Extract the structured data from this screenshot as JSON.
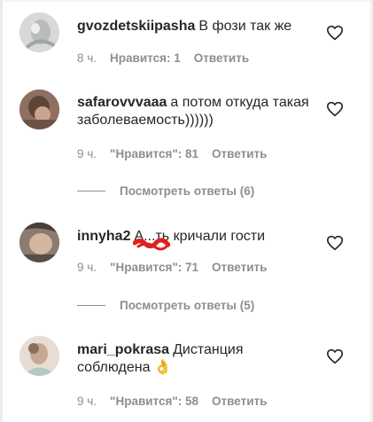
{
  "comments": [
    {
      "username": "gvozdetskiipasha",
      "text": "В фози так же",
      "time": "8 ч.",
      "likes": "Нравится: 1",
      "reply": "Ответить",
      "avatar_color": "#d9dcd9"
    },
    {
      "username": "safarovvvaaa",
      "text": "а потом откуда такая заболеваемость))))))",
      "time": "9 ч.",
      "likes": "\"Нравится\": 81",
      "reply": "Ответить",
      "replies_label": "Посмотреть ответы (6)",
      "avatar_color": "#8a6a5a"
    },
    {
      "username": "innyha2",
      "text": "А...ть кричали гости",
      "time": "9 ч.",
      "likes": "\"Нравится\": 71",
      "reply": "Ответить",
      "replies_label": "Посмотреть ответы (5)",
      "avatar_color": "#7a6a5e"
    },
    {
      "username": "mari_pokrasa",
      "text": "Дистанция соблюдена 👌",
      "time": "9 ч.",
      "likes": "\"Нравится\": 58",
      "reply": "Ответить",
      "avatar_color": "#e2d8cf"
    }
  ],
  "colors": {
    "text": "#262626",
    "secondary": "#8e8e8e",
    "scribble": "#e02020"
  }
}
